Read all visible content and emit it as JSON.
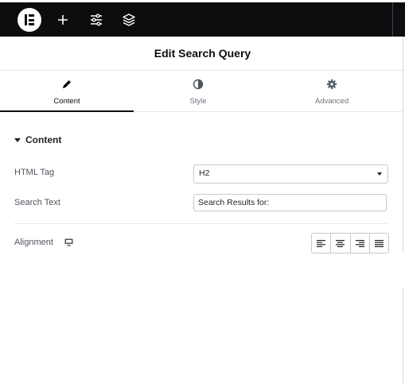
{
  "header": {
    "title": "Edit Search Query"
  },
  "toolbar": {
    "logo_icon": "elementor-logo-icon",
    "add_icon": "plus-icon",
    "settings_icon": "sliders-icon",
    "structure_icon": "layers-icon"
  },
  "tabs": [
    {
      "label": "Content",
      "icon": "pencil-icon",
      "active": true
    },
    {
      "label": "Style",
      "icon": "half-circle-icon",
      "active": false
    },
    {
      "label": "Advanced",
      "icon": "gear-icon",
      "active": false
    }
  ],
  "section": {
    "title": "Content",
    "expanded": true
  },
  "fields": {
    "html_tag": {
      "label": "HTML Tag",
      "value": "H2"
    },
    "search_text": {
      "label": "Search Text",
      "value": "Search Results for:"
    },
    "alignment": {
      "label": "Alignment",
      "device_icon": "desktop-icon",
      "options": [
        "align-left-icon",
        "align-center-icon",
        "align-right-icon",
        "align-justify-icon"
      ]
    }
  },
  "colors": {
    "topbar": "#0c0d0e",
    "text": "#1f2124",
    "muted": "#69727d",
    "border": "#c6c9cd"
  }
}
